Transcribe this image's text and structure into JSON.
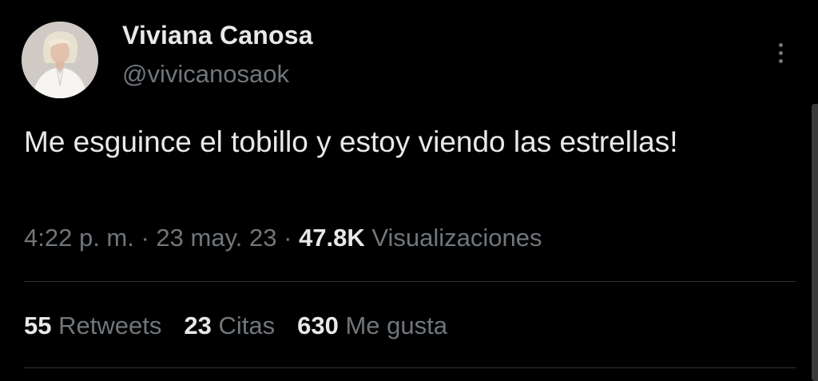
{
  "author": {
    "name": "Viviana Canosa",
    "handle": "@vivicanosaok",
    "avatar_icon": "profile-photo"
  },
  "tweet": {
    "text": "Me esguince el tobillo y estoy viendo las estrellas!",
    "time": "4:22 p. m.",
    "date": "23 may. 23",
    "separator": " · ",
    "views_count": "47.8K",
    "views_label": "Visualizaciones"
  },
  "stats": {
    "retweets_count": "55",
    "retweets_label": "Retweets",
    "quotes_count": "23",
    "quotes_label": "Citas",
    "likes_count": "630",
    "likes_label": "Me gusta"
  },
  "menu": {
    "icon": "more-vertical-icon"
  },
  "colors": {
    "background": "#000000",
    "primary_text": "#e7e9ea",
    "secondary_text": "#71767b",
    "divider": "#2f3336"
  }
}
